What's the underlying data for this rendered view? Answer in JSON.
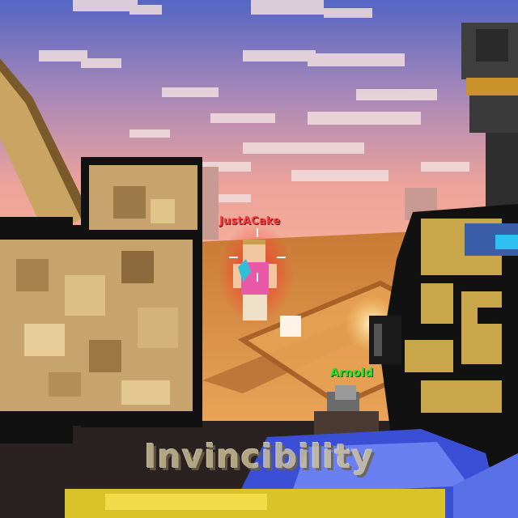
{
  "hud": {
    "powerup_text": "Invincibility",
    "crosshair_icon": "crosshair-icon"
  },
  "players": {
    "enemy": {
      "name": "JustACake",
      "color": "#ff3b3b"
    },
    "ally": {
      "name": "Arnold",
      "color": "#2ee02e"
    }
  },
  "colors": {
    "sky_top": "#5b72c7",
    "sky_bottom": "#f1a89c",
    "ground": "#d98a3a",
    "weapon_gold": "#c9a64a",
    "weapon_blue": "#3a4fd6"
  }
}
